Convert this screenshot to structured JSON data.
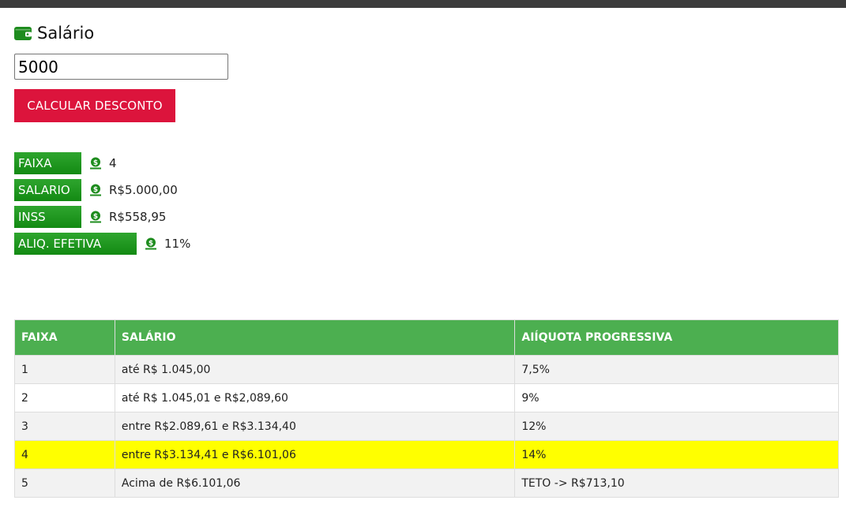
{
  "header": {
    "title": "Salário",
    "icon": "wallet-icon",
    "icon_color": "#1e8c1e"
  },
  "form": {
    "salary_value": "5000",
    "button_label": "CALCULAR DESCONTO",
    "button_color": "#dc143c"
  },
  "summary": [
    {
      "label": "FAIXA",
      "icon": "money-hand-icon",
      "value": "4"
    },
    {
      "label": "SALARIO",
      "icon": "money-hand-icon",
      "value": "R$5.000,00"
    },
    {
      "label": "INSS",
      "icon": "money-hand-icon",
      "value": "R$558,95"
    },
    {
      "label": "ALIQ. EFETIVA",
      "icon": "money-hand-icon",
      "value": "11%"
    }
  ],
  "table": {
    "headers": [
      "FAIXA",
      "SALÁRIO",
      "AIÍQUOTA PROGRESSIVA"
    ],
    "header_color": "#4caf50",
    "highlight_color": "#ffff00",
    "highlighted_faixa": "4",
    "rows": [
      [
        "1",
        "até R$ 1.045,00",
        "7,5%"
      ],
      [
        "2",
        "até R$ 1.045,01 e R$2,089,60",
        "9%"
      ],
      [
        "3",
        "entre R$2.089,61 e R$3.134,40",
        "12%"
      ],
      [
        "4",
        "entre R$3.134,41 e R$6.101,06",
        "14%"
      ],
      [
        "5",
        "Acima de R$6.101,06",
        "TETO -> R$713,10"
      ]
    ]
  }
}
